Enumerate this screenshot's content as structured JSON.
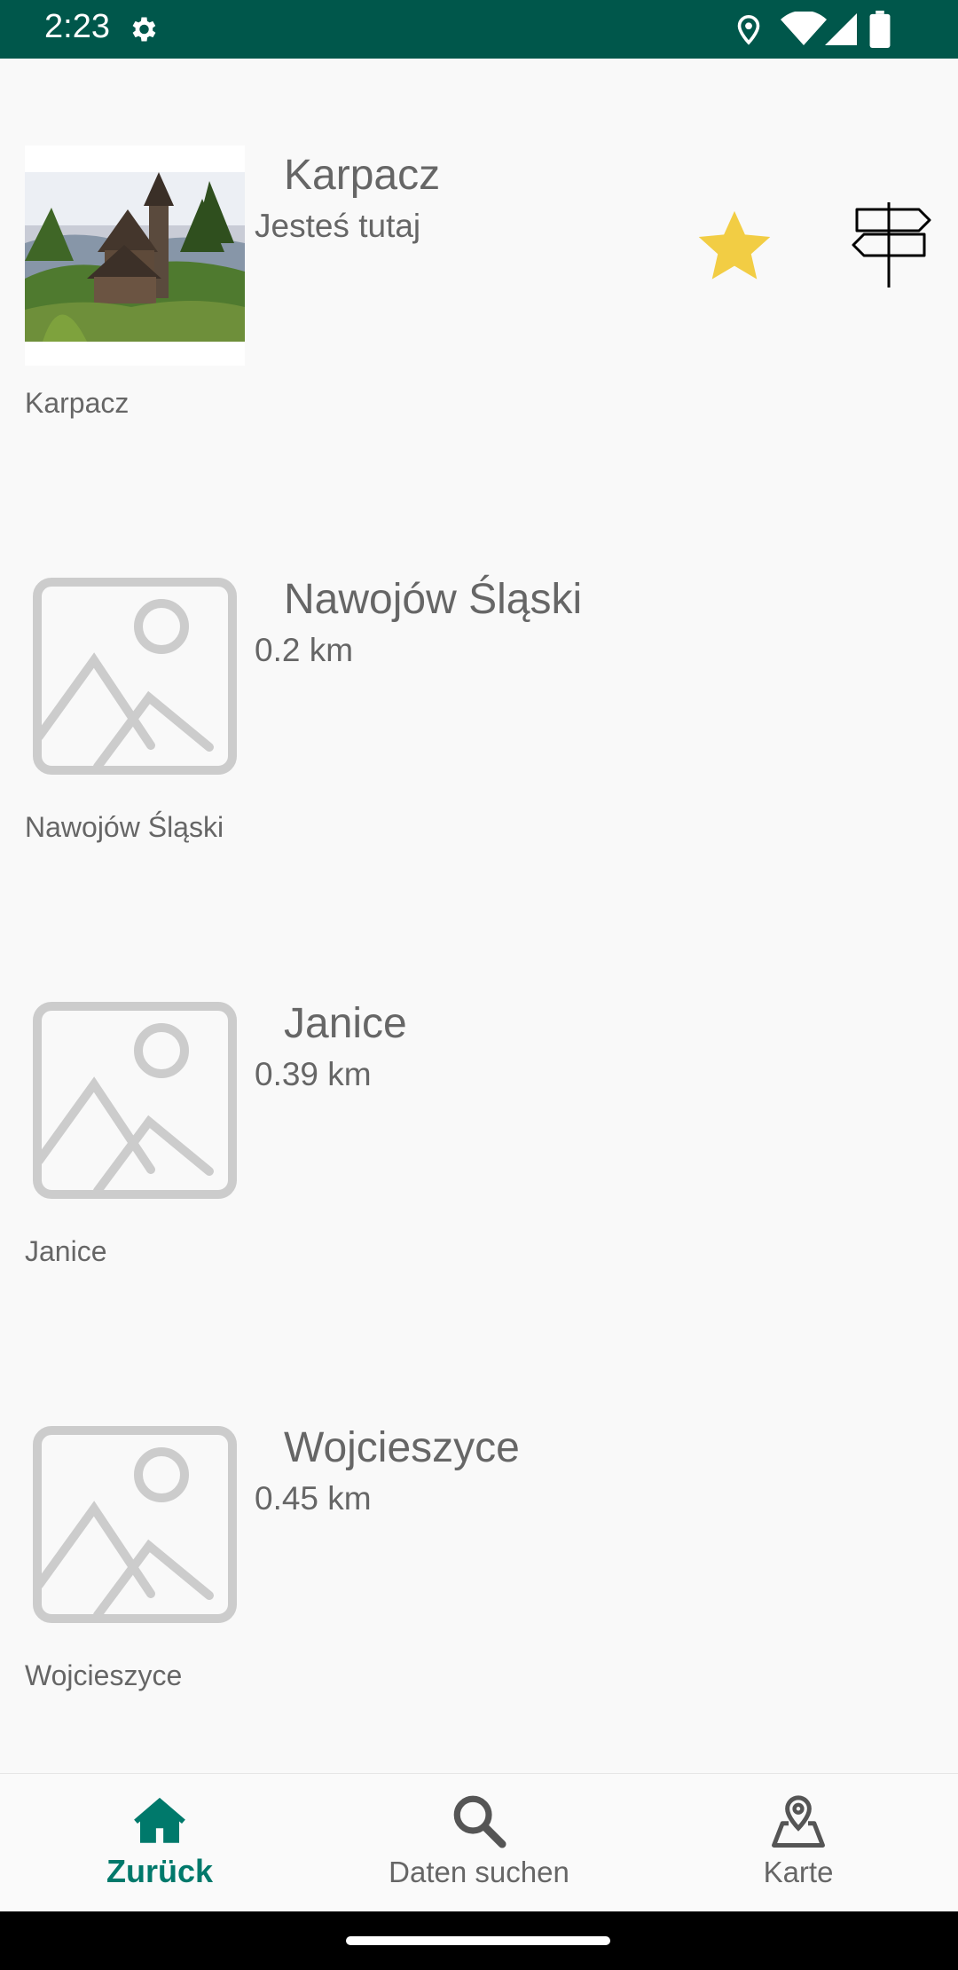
{
  "status_bar": {
    "time": "2:23",
    "icons": [
      "settings-gear-icon",
      "location-pin-icon",
      "wifi-icon",
      "signal-icon",
      "battery-icon"
    ]
  },
  "places": [
    {
      "title": "Karpacz",
      "subtitle": "Jesteś tutaj",
      "caption": "Karpacz",
      "image": "church-photo",
      "favorite": true
    },
    {
      "title": "Nawojów Śląski",
      "subtitle": "0.2 km",
      "caption": "Nawojów Śląski",
      "image": "image-placeholder-icon"
    },
    {
      "title": "Janice",
      "subtitle": "0.39 km",
      "caption": "Janice",
      "image": "image-placeholder-icon"
    },
    {
      "title": "Wojcieszyce",
      "subtitle": "0.45 km",
      "caption": "Wojcieszyce",
      "image": "image-placeholder-icon"
    }
  ],
  "bottom_nav": {
    "items": [
      {
        "label": "Zurück",
        "icon": "home-icon",
        "active": true
      },
      {
        "label": "Daten suchen",
        "icon": "search-icon",
        "active": false
      },
      {
        "label": "Karte",
        "icon": "map-pin-icon",
        "active": false
      }
    ]
  },
  "colors": {
    "status_bar": "#00574b",
    "accent": "#00796b",
    "star": "#f2cd44",
    "text_secondary": "#666666",
    "placeholder": "#cccccc"
  }
}
